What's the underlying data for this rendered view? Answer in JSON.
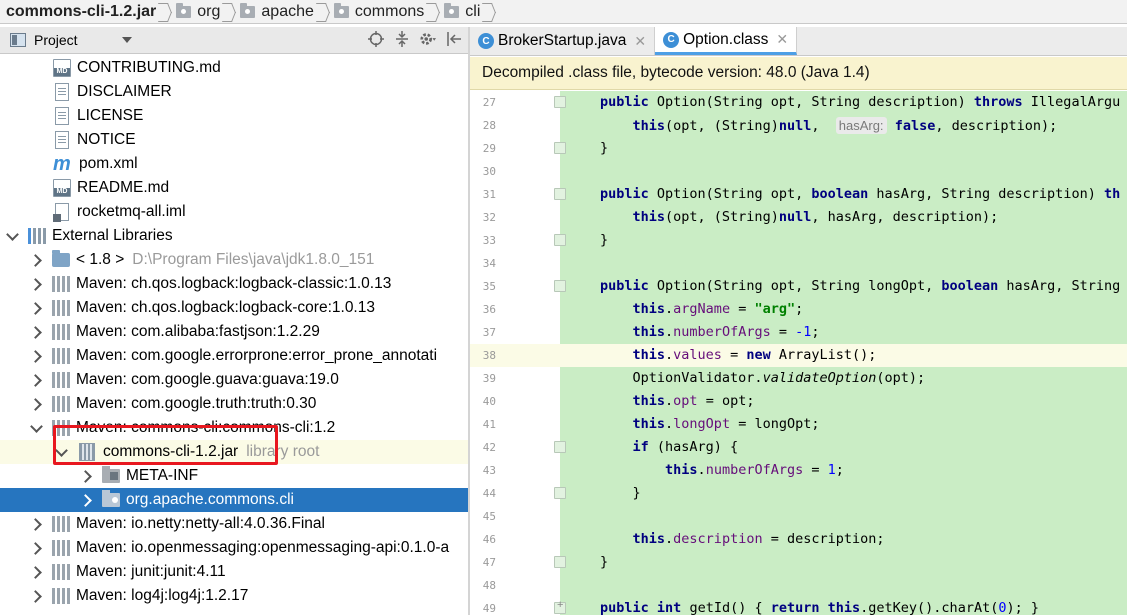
{
  "breadcrumb": {
    "items": [
      {
        "label": "commons-cli-1.2.jar",
        "icon": "jar-icon"
      },
      {
        "label": "org",
        "icon": "package-icon"
      },
      {
        "label": "apache",
        "icon": "package-icon"
      },
      {
        "label": "commons",
        "icon": "package-icon"
      },
      {
        "label": "cli",
        "icon": "package-icon"
      }
    ]
  },
  "project_panel": {
    "title": "Project"
  },
  "tree": {
    "contributing": "CONTRIBUTING.md",
    "disclaimer": "DISCLAIMER",
    "license": "LICENSE",
    "notice": "NOTICE",
    "pom": "pom.xml",
    "readme": "README.md",
    "iml": "rocketmq-all.iml",
    "external_libraries": "External Libraries",
    "jdk_label": "< 1.8 >",
    "jdk_path": "D:\\Program Files\\java\\jdk1.8.0_151",
    "libs": [
      "Maven: ch.qos.logback:logback-classic:1.0.13",
      "Maven: ch.qos.logback:logback-core:1.0.13",
      "Maven: com.alibaba:fastjson:1.2.29",
      "Maven: com.google.errorprone:error_prone_annotati",
      "Maven: com.google.guava:guava:19.0",
      "Maven: com.google.truth:truth:0.30",
      "Maven: commons-cli:commons-cli:1.2"
    ],
    "jar": "commons-cli-1.2.jar",
    "jar_note": "library root",
    "meta_inf": "META-INF",
    "pkg": "org.apache.commons.cli",
    "libs_after": [
      "Maven: io.netty:netty-all:4.0.36.Final",
      "Maven: io.openmessaging:openmessaging-api:0.1.0-a",
      "Maven: junit:junit:4.11",
      "Maven: log4j:log4j:1.2.17"
    ]
  },
  "tabs": [
    {
      "label": "BrokerStartup.java",
      "active": false
    },
    {
      "label": "Option.class",
      "active": true
    }
  ],
  "notice": "Decompiled .class file, bytecode version: 48.0 (Java 1.4)",
  "code": {
    "line_numbers": [
      "27",
      "28",
      "29",
      "30",
      "31",
      "32",
      "33",
      "34",
      "35",
      "36",
      "37",
      "38",
      "39",
      "40",
      "41",
      "42",
      "43",
      "44",
      "45",
      "46",
      "47",
      "48",
      "49"
    ],
    "hint_label": "hasArg:"
  }
}
